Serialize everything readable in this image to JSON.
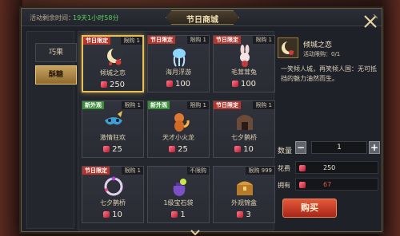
{
  "header": {
    "time_label": "活动剩余时间：",
    "time_value": "19天1小时58分",
    "title": "节日商城"
  },
  "tabs": [
    {
      "label": "巧果",
      "active": false
    },
    {
      "label": "酥糖",
      "active": true
    }
  ],
  "items": [
    {
      "tag": "节日限定",
      "tag_type": "holiday",
      "limit": "限购 1",
      "name": "倾城之恋",
      "price": "250",
      "icon": "crescent-moon-icon",
      "selected": true
    },
    {
      "tag": "节日限定",
      "tag_type": "holiday",
      "limit": "限购 1",
      "name": "海月浮游",
      "price": "100",
      "icon": "jellyfish-icon",
      "selected": false
    },
    {
      "tag": "节日限定",
      "tag_type": "holiday",
      "limit": "限购 1",
      "name": "毛茸茸兔",
      "price": "100",
      "icon": "bunny-icon",
      "selected": false
    },
    {
      "tag": "新外观",
      "tag_type": "new",
      "limit": "限购 1",
      "name": "激情狂欢",
      "price": "25",
      "icon": "carnival-mask-icon",
      "selected": false
    },
    {
      "tag": "新外观",
      "tag_type": "new",
      "limit": "限购 1",
      "name": "天才小火龙",
      "price": "25",
      "icon": "little-dragon-icon",
      "selected": false
    },
    {
      "tag": "节日限定",
      "tag_type": "holiday",
      "limit": "限购 1",
      "name": "七夕鹊桥",
      "price": "10",
      "icon": "bridge-icon",
      "selected": false
    },
    {
      "tag": "节日限定",
      "tag_type": "holiday",
      "limit": "限购 1",
      "name": "七夕鹊桥",
      "price": "10",
      "icon": "ring-frame-icon",
      "selected": false
    },
    {
      "tag": "",
      "tag_type": "",
      "limit": "不限购",
      "name": "1级宝石袋",
      "price": "1",
      "icon": "gem-bag-icon",
      "selected": false
    },
    {
      "tag": "",
      "tag_type": "",
      "limit": "限购 999",
      "name": "外观锦盒",
      "price": "3",
      "icon": "treasure-box-icon",
      "selected": false
    }
  ],
  "detail": {
    "name": "倾城之恋",
    "limit": "活动限购：0/1",
    "description": "一笑倾人城，再笑倾人国：无可抵挡的魅力油然而生。",
    "qty_label": "数量",
    "qty_value": "1",
    "cost_label": "花费",
    "cost_value": "250",
    "own_label": "拥有",
    "own_value": "67",
    "buy_label": "购买"
  },
  "colors": {
    "holiday_tag": "#b3362e",
    "new_tag": "#3d8f3a",
    "insufficient": "#e0524a",
    "selected_border": "#e8c05a"
  }
}
